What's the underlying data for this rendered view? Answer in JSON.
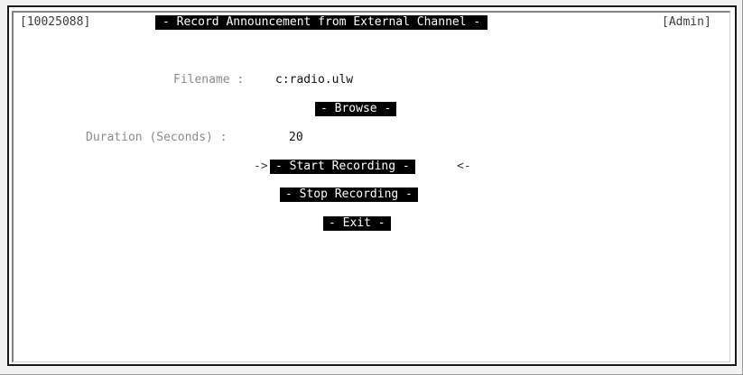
{
  "header": {
    "record_id": "[10025088]",
    "title": "- Record Announcement from External Channel -",
    "user_role": "[Admin]"
  },
  "form": {
    "filename_label": "Filename :",
    "filename_value": "c:radio.ulw",
    "duration_label": "Duration (Seconds) :",
    "duration_value": "20"
  },
  "buttons": {
    "browse": "- Browse -",
    "start_recording": "- Start Recording -",
    "stop_recording": "- Stop Recording -",
    "exit": "- Exit -"
  },
  "focus": {
    "left_arrow": "->",
    "right_arrow": "<-"
  }
}
